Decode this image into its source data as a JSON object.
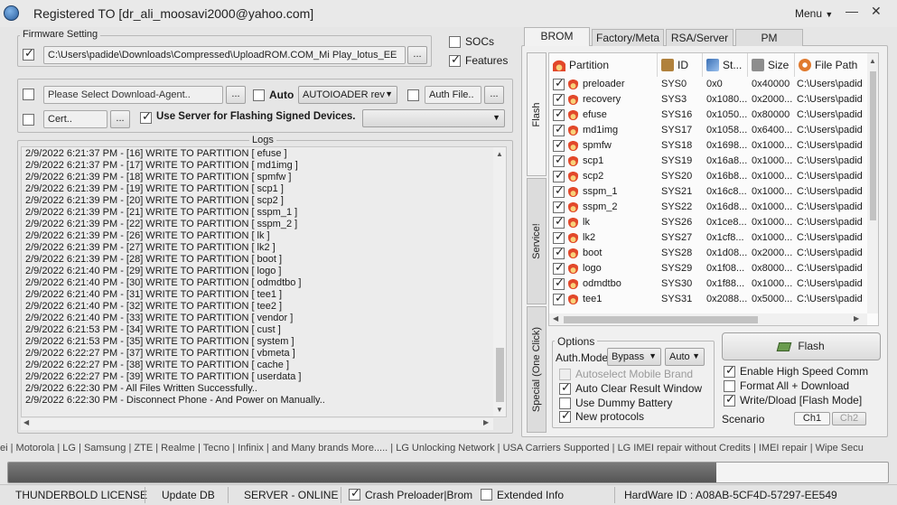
{
  "window": {
    "title": "Registered TO [dr_ali_moosavi2000@yahoo.com]",
    "menu_label": "Menu",
    "minimize_glyph": "—",
    "close_glyph": "✕"
  },
  "firmware": {
    "legend": "Firmware Setting",
    "path": "C:\\Users\\padide\\Downloads\\Compressed\\UploadROM.COM_Mi Play_lotus_EE",
    "browse_label": "...",
    "checked": true
  },
  "options_right": {
    "socs_label": "SOCs",
    "socs_checked": false,
    "features_label": "Features",
    "features_checked": true
  },
  "agent": {
    "da_placeholder": "Please Select Download-Agent..",
    "da_browse": "...",
    "auto_label": "Auto",
    "auto_checked": false,
    "loader_value": "AUTOIOADER rev",
    "auth_placeholder": "Auth File..",
    "auth_browse": "...",
    "cert_placeholder": "Cert..",
    "cert_browse": "...",
    "use_server_label": "Use Server for Flashing Signed Devices.",
    "use_server_checked": true,
    "server_value": ""
  },
  "logs": {
    "legend": "Logs",
    "lines": [
      "2/9/2022 6:21:37 PM - [16] WRITE TO PARTITION [ efuse ]",
      "2/9/2022 6:21:37 PM - [17] WRITE TO PARTITION [ md1img ]",
      "2/9/2022 6:21:39 PM - [18] WRITE TO PARTITION [ spmfw ]",
      "2/9/2022 6:21:39 PM - [19] WRITE TO PARTITION [ scp1 ]",
      "2/9/2022 6:21:39 PM - [20] WRITE TO PARTITION [ scp2 ]",
      "2/9/2022 6:21:39 PM - [21] WRITE TO PARTITION [ sspm_1 ]",
      "2/9/2022 6:21:39 PM - [22] WRITE TO PARTITION [ sspm_2 ]",
      "2/9/2022 6:21:39 PM - [26] WRITE TO PARTITION [ lk ]",
      "2/9/2022 6:21:39 PM - [27] WRITE TO PARTITION [ lk2 ]",
      "2/9/2022 6:21:39 PM - [28] WRITE TO PARTITION [ boot ]",
      "2/9/2022 6:21:40 PM - [29] WRITE TO PARTITION [ logo ]",
      "2/9/2022 6:21:40 PM - [30] WRITE TO PARTITION [ odmdtbo ]",
      "2/9/2022 6:21:40 PM - [31] WRITE TO PARTITION [ tee1 ]",
      "2/9/2022 6:21:40 PM - [32] WRITE TO PARTITION [ tee2 ]",
      "2/9/2022 6:21:40 PM - [33] WRITE TO PARTITION [ vendor ]",
      "2/9/2022 6:21:53 PM - [34] WRITE TO PARTITION [ cust ]",
      "2/9/2022 6:21:53 PM - [35] WRITE TO PARTITION [ system ]",
      "2/9/2022 6:22:27 PM - [37] WRITE TO PARTITION [ vbmeta ]",
      "2/9/2022 6:22:27 PM - [38] WRITE TO PARTITION [ cache ]",
      "2/9/2022 6:22:27 PM - [39] WRITE TO PARTITION [ userdata ]",
      "2/9/2022 6:22:30 PM - All Files Written Successfully..",
      "2/9/2022 6:22:30 PM - Disconnect Phone - And Power on Manually.."
    ]
  },
  "tabs": [
    "BROM",
    "Factory/Meta",
    "RSA/Server",
    "PM"
  ],
  "vtabs": [
    "Flash",
    "Service!",
    "Special (One Click)"
  ],
  "partition_table": {
    "headers": [
      "Partition",
      "ID",
      "St...",
      "Size",
      "File Path"
    ],
    "rows": [
      {
        "name": "preloader",
        "id": "SYS0",
        "start": "0x0",
        "size": "0x40000",
        "path": "C:\\Users\\padid"
      },
      {
        "name": "recovery",
        "id": "SYS3",
        "start": "0x1080...",
        "size": "0x2000...",
        "path": "C:\\Users\\padid"
      },
      {
        "name": "efuse",
        "id": "SYS16",
        "start": "0x1050...",
        "size": "0x80000",
        "path": "C:\\Users\\padid"
      },
      {
        "name": "md1img",
        "id": "SYS17",
        "start": "0x1058...",
        "size": "0x6400...",
        "path": "C:\\Users\\padid"
      },
      {
        "name": "spmfw",
        "id": "SYS18",
        "start": "0x1698...",
        "size": "0x1000...",
        "path": "C:\\Users\\padid"
      },
      {
        "name": "scp1",
        "id": "SYS19",
        "start": "0x16a8...",
        "size": "0x1000...",
        "path": "C:\\Users\\padid"
      },
      {
        "name": "scp2",
        "id": "SYS20",
        "start": "0x16b8...",
        "size": "0x1000...",
        "path": "C:\\Users\\padid"
      },
      {
        "name": "sspm_1",
        "id": "SYS21",
        "start": "0x16c8...",
        "size": "0x1000...",
        "path": "C:\\Users\\padid"
      },
      {
        "name": "sspm_2",
        "id": "SYS22",
        "start": "0x16d8...",
        "size": "0x1000...",
        "path": "C:\\Users\\padid"
      },
      {
        "name": "lk",
        "id": "SYS26",
        "start": "0x1ce8...",
        "size": "0x1000...",
        "path": "C:\\Users\\padid"
      },
      {
        "name": "lk2",
        "id": "SYS27",
        "start": "0x1cf8...",
        "size": "0x1000...",
        "path": "C:\\Users\\padid"
      },
      {
        "name": "boot",
        "id": "SYS28",
        "start": "0x1d08...",
        "size": "0x2000...",
        "path": "C:\\Users\\padid"
      },
      {
        "name": "logo",
        "id": "SYS29",
        "start": "0x1f08...",
        "size": "0x8000...",
        "path": "C:\\Users\\padid"
      },
      {
        "name": "odmdtbo",
        "id": "SYS30",
        "start": "0x1f88...",
        "size": "0x1000...",
        "path": "C:\\Users\\padid"
      },
      {
        "name": "tee1",
        "id": "SYS31",
        "start": "0x2088...",
        "size": "0x5000...",
        "path": "C:\\Users\\padid"
      }
    ]
  },
  "options": {
    "legend": "Options",
    "auth_mode_label": "Auth.Mode",
    "auth_mode_value": "Bypass",
    "auto_value": "Auto",
    "autoselect_label": "Autoselect Mobile Brand",
    "auto_clear_label": "Auto Clear Result Window",
    "dummy_battery_label": "Use Dummy Battery",
    "new_protocols_label": "New protocols"
  },
  "flash_panel": {
    "flash_label": "Flash",
    "high_speed_label": "Enable High Speed Comm",
    "format_all_label": "Format All + Download",
    "write_dload_label": "Write/Dload [Flash Mode]",
    "scenario_label": "Scenario",
    "ch1": "Ch1",
    "ch2": "Ch2"
  },
  "marquee": "ei | Motorola | LG | Samsung | ZTE | Realme | Tecno | Infinix | and Many brands More..... | LG Unlocking Network | USA Carriers Supported | LG IMEI repair without Credits | IMEI repair | Wipe Secu",
  "progress_fraction": 0.805,
  "statusbar": {
    "license": "THUNDERBOLD LICENSE",
    "update_db": "Update DB",
    "server": "SERVER - ONLINE",
    "crash_preloader": "Crash Preloader|Brom",
    "extended_info": "Extended Info",
    "hardware_id": "HardWare ID : A08AB-5CF4D-57297-EE549"
  },
  "colors": {
    "accent_blue": "#2b5f9e",
    "progress_fill": "#5f5f5f"
  }
}
